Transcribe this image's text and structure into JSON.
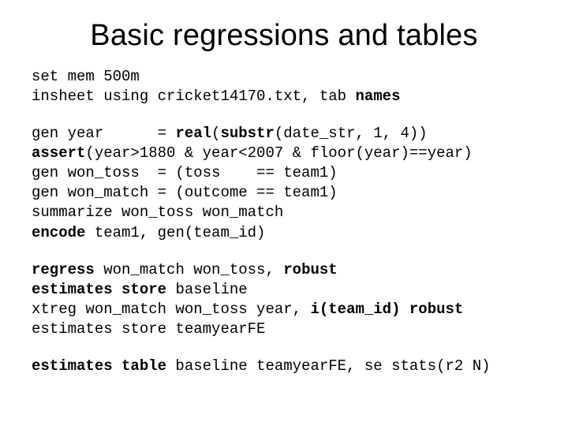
{
  "title": "Basic regressions and tables",
  "block1": {
    "l1a": "set mem 500m",
    "l2a": "insheet using cricket14170.txt, tab ",
    "l2b": "names"
  },
  "block2": {
    "l1a": "gen year      = ",
    "l1b": "real",
    "l1c": "(",
    "l1d": "substr",
    "l1e": "(date_str, 1, 4))",
    "l2a": "assert",
    "l2b": "(year>1880 & year<2007 & floor(year)==year)",
    "l3a": "gen won_toss  = (toss    == team1)",
    "l4a": "gen won_match = (outcome == team1)",
    "l5a": "summarize won_toss won_match",
    "l6a": "encode",
    "l6b": " team1, gen(team_id)"
  },
  "block3": {
    "l1a": "regress",
    "l1b": " won_match won_toss, ",
    "l1c": "robust",
    "l2a": "estimates store ",
    "l2b": "baseline",
    "l3a": "xtreg won_match won_toss year, ",
    "l3b": "i(team_id) robust",
    "l4a": "estimates store teamyearFE"
  },
  "block4": {
    "l1a": "estimates table",
    "l1b": " baseline teamyearFE, se stats(r2 N)"
  }
}
